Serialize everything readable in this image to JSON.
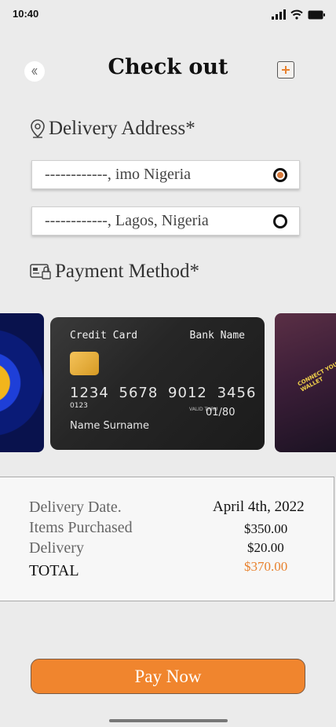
{
  "status_bar": {
    "time": "10:40"
  },
  "header": {
    "title": "Check out"
  },
  "delivery": {
    "heading": "Delivery Address*",
    "addresses": [
      {
        "text": "------------, imo Nigeria",
        "selected": true
      },
      {
        "text": "------------, Lagos, Nigeria",
        "selected": false
      }
    ]
  },
  "payment": {
    "heading": "Payment Method*",
    "card": {
      "type": "Credit Card",
      "bank": "Bank Name",
      "number": "1234 5678 9012 3456",
      "number_small": "0123",
      "valid_label": "VALID THRU",
      "expiry": "01/80",
      "holder": "Name Surname"
    },
    "wallet_text": "CONNECT YOUR WALLET"
  },
  "summary": {
    "delivery_date_label": "Delivery Date.",
    "delivery_date_value": "April 4th, 2022",
    "items_label": "Items Purchased",
    "items_value": "$350.00",
    "delivery_label": "Delivery",
    "delivery_value": "$20.00",
    "total_label": "TOTAL",
    "total_value": "$370.00"
  },
  "actions": {
    "pay_label": "Pay Now"
  },
  "colors": {
    "accent": "#f0852e",
    "total": "#e8812e",
    "background": "#ebebeb"
  }
}
